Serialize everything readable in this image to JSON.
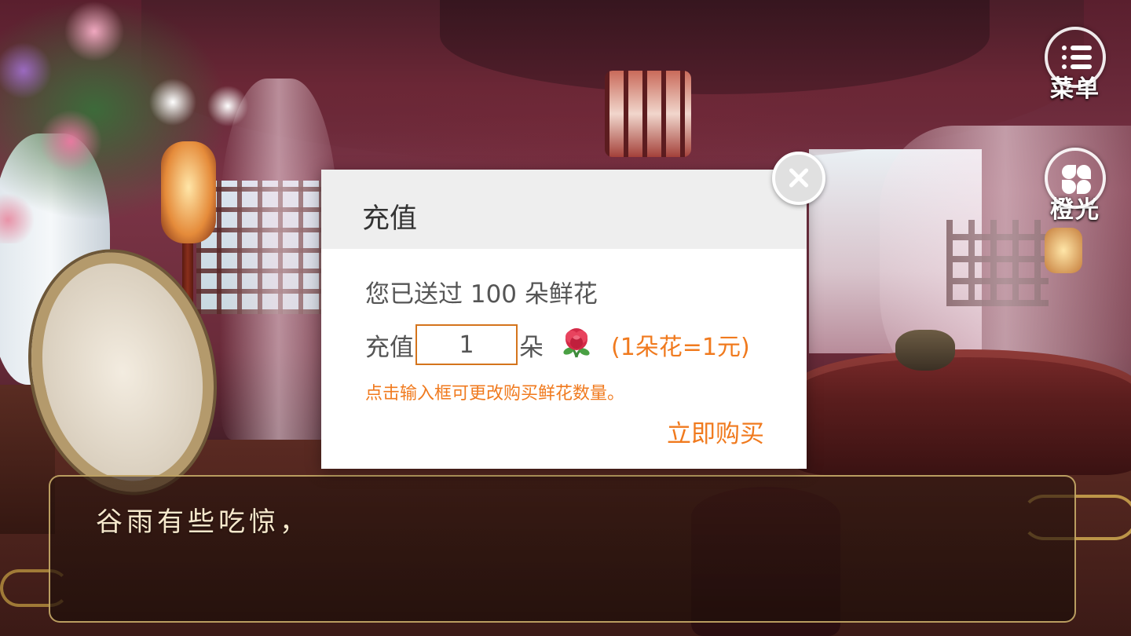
{
  "hud": {
    "menu_label": "菜单",
    "menu_icon": "menu-list-icon",
    "skip_label": "橙光",
    "skip_icon": "orange-light-logo-icon"
  },
  "modal": {
    "title": "充值",
    "sent_text": "您已送过 100 朵鲜花",
    "recharge_label": "充值",
    "quantity_value": "1",
    "unit_label": "朵",
    "flower_icon": "rose-icon",
    "price_note": "(1朵花=1元)",
    "hint": "点击输入框可更改购买鲜花数量。",
    "buy_label": "立即购买",
    "close_icon": "close-icon",
    "accent_color": "#f07a1e",
    "input_border_color": "#d4741c"
  },
  "dialogue": {
    "text": "谷雨有些吃惊，"
  }
}
